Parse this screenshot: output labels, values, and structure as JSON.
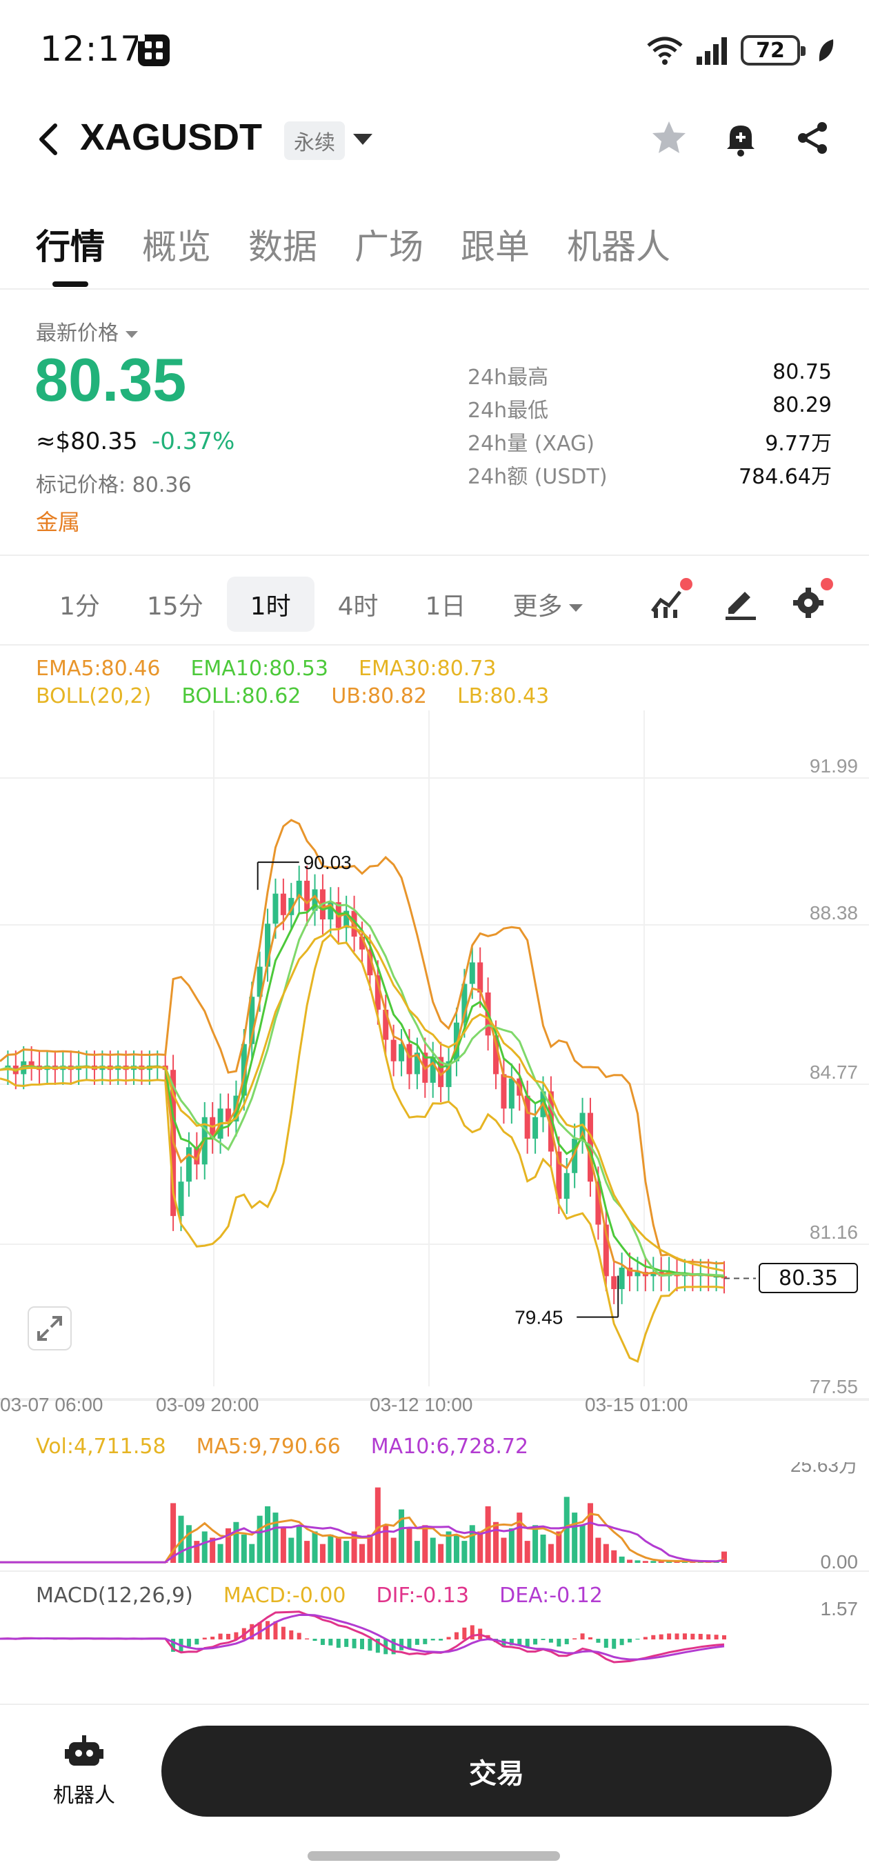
{
  "status_bar": {
    "time": "12:17",
    "battery": "72",
    "icons": [
      "app-icon",
      "wifi-icon",
      "signal-icon",
      "battery-icon",
      "leaf-icon"
    ]
  },
  "header": {
    "symbol": "XAGUSDT",
    "badge": "永续",
    "icons": [
      "back-icon",
      "star-icon",
      "bell-icon",
      "share-icon"
    ]
  },
  "tabs": [
    "行情",
    "概览",
    "数据",
    "广场",
    "跟单",
    "机器人"
  ],
  "active_tab": "行情",
  "price": {
    "latest_label": "最新价格",
    "last": "80.35",
    "usd": "≈$80.35",
    "change_pct": "-0.37%",
    "mark_label": "标记价格: 80.36",
    "category": "金属"
  },
  "stats": [
    {
      "label": "24h最高",
      "value": "80.75"
    },
    {
      "label": "24h最低",
      "value": "80.29"
    },
    {
      "label": "24h量 (XAG)",
      "value": "9.77万"
    },
    {
      "label": "24h额 (USDT)",
      "value": "784.64万"
    }
  ],
  "intervals": [
    "1分",
    "15分",
    "1时",
    "4时",
    "1日"
  ],
  "active_interval": "1时",
  "more_label": "更多",
  "indicators": {
    "ema_row": [
      {
        "text": "EMA5:80.46",
        "color": "#e8952b"
      },
      {
        "text": "EMA10:80.53",
        "color": "#4cc93a"
      },
      {
        "text": "EMA30:80.73",
        "color": "#e6b422"
      }
    ],
    "boll_row": [
      {
        "text": "BOLL(20,2)",
        "color": "#e6b422"
      },
      {
        "text": "BOLL:80.62",
        "color": "#4cc93a"
      },
      {
        "text": "UB:80.82",
        "color": "#e8952b"
      },
      {
        "text": "LB:80.43",
        "color": "#e6b422"
      }
    ],
    "vol_row": [
      {
        "text": "Vol:4,711.58",
        "color": "#e6b422"
      },
      {
        "text": "MA5:9,790.66",
        "color": "#e8952b"
      },
      {
        "text": "MA10:6,728.72",
        "color": "#b23bd1"
      }
    ],
    "macd_row": [
      {
        "text": "MACD(12,26,9)",
        "color": "#555555"
      },
      {
        "text": "MACD:-0.00",
        "color": "#e6b422"
      },
      {
        "text": "DIF:-0.13",
        "color": "#e0338a"
      },
      {
        "text": "DEA:-0.12",
        "color": "#b23bd1"
      }
    ]
  },
  "chart_data": {
    "type": "candlestick",
    "y_ticks": [
      "91.99",
      "88.38",
      "84.77",
      "81.16",
      "77.55"
    ],
    "x_ticks": [
      "03-07 06:00",
      "03-09 20:00",
      "03-12 10:00",
      "03-15 01:00"
    ],
    "high_label": "90.03",
    "low_label": "79.45",
    "last_price_tag": "80.35",
    "volume_axis": [
      "25.63万",
      "0.00"
    ],
    "macd_axis": [
      "1.57"
    ],
    "ylim": [
      77.55,
      91.99
    ],
    "close_series": [
      85.2,
      85.3,
      85.1,
      85.4,
      85.3,
      85.2,
      85.3,
      85.2,
      85.3,
      85.2,
      85.3,
      85.3,
      85.2,
      85.3,
      85.2,
      85.3,
      85.2,
      85.3,
      85.2,
      85.3,
      85.3,
      85.2,
      81.8,
      82.6,
      83.4,
      83.0,
      84.1,
      83.6,
      84.3,
      84.0,
      84.6,
      85.8,
      86.9,
      87.6,
      88.6,
      89.3,
      88.8,
      89.2,
      89.6,
      88.9,
      89.4,
      88.7,
      89.1,
      88.5,
      88.9,
      88.3,
      88.0,
      87.4,
      86.6,
      85.9,
      85.4,
      85.8,
      85.1,
      85.6,
      84.9,
      85.5,
      84.8,
      85.4,
      86.3,
      87.2,
      87.7,
      87.0,
      86.0,
      85.1,
      84.3,
      85.0,
      84.6,
      83.6,
      84.1,
      84.7,
      83.3,
      82.2,
      82.8,
      83.6,
      84.2,
      82.6,
      81.6,
      80.4,
      80.1,
      80.6,
      80.4,
      80.5,
      80.4,
      80.5,
      80.4,
      80.5,
      80.4,
      80.45,
      80.4,
      80.45,
      80.4,
      80.4,
      80.35
    ],
    "volume_series": [
      0.1,
      0.1,
      0.1,
      0.1,
      0.1,
      0.1,
      0.1,
      0.1,
      0.1,
      0.1,
      0.1,
      0.1,
      0.1,
      0.1,
      0.1,
      0.1,
      0.1,
      0.1,
      0.1,
      0.1,
      0.1,
      0.1,
      9.5,
      7.5,
      6.0,
      3.5,
      5.0,
      4.0,
      3.0,
      5.5,
      6.5,
      4.5,
      3.0,
      7.5,
      9.0,
      8.0,
      5.5,
      4.0,
      6.0,
      3.5,
      5.0,
      3.0,
      4.5,
      4.0,
      3.5,
      5.0,
      3.0,
      4.5,
      12.0,
      6.0,
      4.0,
      8.5,
      5.5,
      3.5,
      6.0,
      4.0,
      3.0,
      5.0,
      4.5,
      3.5,
      6.0,
      5.0,
      9.0,
      6.5,
      4.0,
      5.5,
      8.0,
      3.5,
      6.0,
      4.5,
      3.0,
      5.0,
      10.5,
      8.0,
      6.0,
      9.5,
      4.0,
      3.0,
      2.0,
      1.0,
      0.5,
      0.4,
      0.3,
      0.3,
      0.3,
      0.3,
      0.2,
      0.2,
      0.2,
      0.2,
      0.2,
      0.3,
      1.8
    ]
  },
  "bottom": {
    "robot_label": "机器人",
    "trade_label": "交易"
  }
}
